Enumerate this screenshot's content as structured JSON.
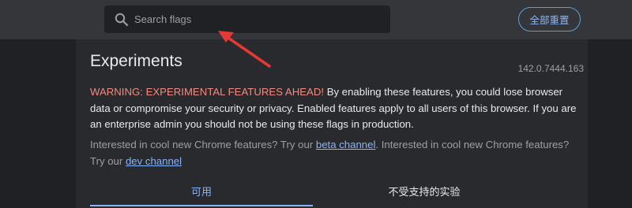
{
  "search": {
    "placeholder": "Search flags",
    "value": ""
  },
  "header": {
    "reset_label": "全部重置"
  },
  "main": {
    "title": "Experiments",
    "version": "142.0.7444.163",
    "warning_label": "WARNING: EXPERIMENTAL FEATURES AHEAD!",
    "warning_body": " By enabling these features, you could lose browser data or compromise your security or privacy. Enabled features apply to all users of this browser. If you are an enterprise admin you should not be using these flags in production.",
    "info_part1": "Interested in cool new Chrome features? Try our ",
    "beta_link": "beta channel",
    "info_part2": ". Interested in cool new Chrome features? Try our ",
    "dev_link": "dev channel",
    "tabs": [
      {
        "label": "可用"
      },
      {
        "label": "不受支持的实验"
      }
    ]
  },
  "colors": {
    "background": "#202124",
    "topbar": "#35363a",
    "accent": "#8ab4f8",
    "warning": "#f28b82",
    "annotation_arrow": "#e53935"
  }
}
